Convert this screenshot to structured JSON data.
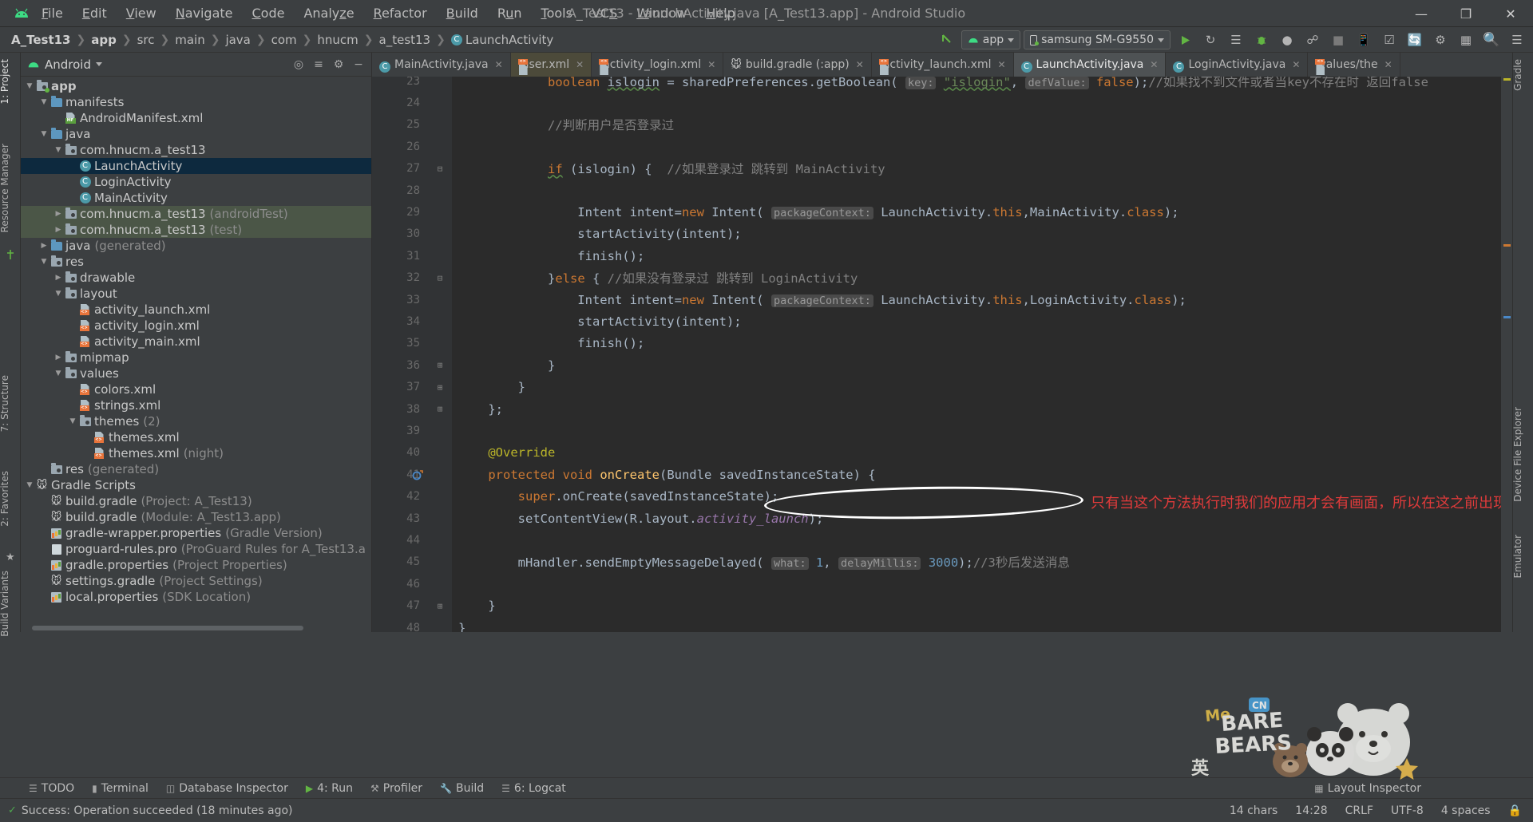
{
  "window": {
    "title": "A_Test13 - LaunchActivity.java [A_Test13.app] - Android Studio",
    "minimize": "—",
    "maximize": "❐",
    "close": "✕"
  },
  "menu": [
    {
      "label": "File"
    },
    {
      "label": "Edit"
    },
    {
      "label": "View"
    },
    {
      "label": "Navigate"
    },
    {
      "label": "Code"
    },
    {
      "label": "Analyze"
    },
    {
      "label": "Refactor"
    },
    {
      "label": "Build"
    },
    {
      "label": "Run"
    },
    {
      "label": "Tools"
    },
    {
      "label": "VCS"
    },
    {
      "label": "Window"
    },
    {
      "label": "Help"
    }
  ],
  "breadcrumb": [
    {
      "label": "A_Test13",
      "bold": true
    },
    {
      "label": "app",
      "bold": true
    },
    {
      "label": "src",
      "bold": false
    },
    {
      "label": "main",
      "bold": false
    },
    {
      "label": "java",
      "bold": false
    },
    {
      "label": "com",
      "bold": false
    },
    {
      "label": "hnucm",
      "bold": false
    },
    {
      "label": "a_test13",
      "bold": false
    },
    {
      "label": "LaunchActivity",
      "bold": false,
      "icon": "class-icon"
    }
  ],
  "toolbar": {
    "module_selector": "app",
    "device_selector": "samsung SM-G9550",
    "run_icon": "run-icon",
    "rerun_icon": "rerun-icon",
    "apply_changes_icon": "apply-changes-icon",
    "debug_icon": "debug-icon",
    "profile_icon": "profile-icon",
    "attach_debugger_icon": "attach-debugger-icon",
    "stop_icon": "stop-icon",
    "avd_icon": "avd-manager-icon",
    "sdk_icon": "sdk-manager-icon",
    "sync_icon": "sync-gradle-icon",
    "search_icon": "search-icon",
    "layout_icon": "layout-inspector-icon"
  },
  "left_rail": [
    {
      "label": "1: Project",
      "active": true
    },
    {
      "label": "Resource Manager",
      "active": false
    },
    {
      "label": "7: Structure",
      "active": false
    },
    {
      "label": "2: Favorites",
      "active": false
    },
    {
      "label": "Build Variants",
      "active": false
    }
  ],
  "right_rail": [
    {
      "label": "Gradle"
    },
    {
      "label": "Device File Explorer"
    },
    {
      "label": "Emulator"
    }
  ],
  "project_panel": {
    "view_selector": "Android",
    "locate_icon": "locate-icon",
    "collapse_icon": "collapse-all-icon",
    "settings_icon": "gear-icon",
    "hide_icon": "hide-icon",
    "tree": [
      {
        "depth": 0,
        "arrow": "down",
        "icon": "folder-module",
        "label": "app",
        "bold": true,
        "dim": ""
      },
      {
        "depth": 1,
        "arrow": "down",
        "icon": "folder-blue",
        "label": "manifests",
        "dim": ""
      },
      {
        "depth": 2,
        "arrow": "none",
        "icon": "manifest-file",
        "label": "AndroidManifest.xml",
        "dim": ""
      },
      {
        "depth": 1,
        "arrow": "down",
        "icon": "folder-blue",
        "label": "java",
        "dim": ""
      },
      {
        "depth": 2,
        "arrow": "down",
        "icon": "folder-src",
        "label": "com.hnucm.a_test13",
        "dim": ""
      },
      {
        "depth": 3,
        "arrow": "none",
        "icon": "class-icon",
        "label": "LaunchActivity",
        "dim": "",
        "state": "selected"
      },
      {
        "depth": 3,
        "arrow": "none",
        "icon": "class-icon",
        "label": "LoginActivity",
        "dim": ""
      },
      {
        "depth": 3,
        "arrow": "none",
        "icon": "class-icon",
        "label": "MainActivity",
        "dim": ""
      },
      {
        "depth": 2,
        "arrow": "right",
        "icon": "folder-src",
        "label": "com.hnucm.a_test13",
        "dim": "(androidTest)",
        "state": "green"
      },
      {
        "depth": 2,
        "arrow": "right",
        "icon": "folder-src",
        "label": "com.hnucm.a_test13",
        "dim": "(test)",
        "state": "green"
      },
      {
        "depth": 1,
        "arrow": "right",
        "icon": "folder-gen",
        "label": "java",
        "dim": "(generated)"
      },
      {
        "depth": 1,
        "arrow": "down",
        "icon": "folder-res",
        "label": "res",
        "dim": ""
      },
      {
        "depth": 2,
        "arrow": "right",
        "icon": "folder-src",
        "label": "drawable",
        "dim": ""
      },
      {
        "depth": 2,
        "arrow": "down",
        "icon": "folder-src",
        "label": "layout",
        "dim": ""
      },
      {
        "depth": 3,
        "arrow": "none",
        "icon": "xml-file",
        "label": "activity_launch.xml",
        "dim": ""
      },
      {
        "depth": 3,
        "arrow": "none",
        "icon": "xml-file",
        "label": "activity_login.xml",
        "dim": ""
      },
      {
        "depth": 3,
        "arrow": "none",
        "icon": "xml-file",
        "label": "activity_main.xml",
        "dim": ""
      },
      {
        "depth": 2,
        "arrow": "right",
        "icon": "folder-src",
        "label": "mipmap",
        "dim": ""
      },
      {
        "depth": 2,
        "arrow": "down",
        "icon": "folder-src",
        "label": "values",
        "dim": ""
      },
      {
        "depth": 3,
        "arrow": "none",
        "icon": "xml-file",
        "label": "colors.xml",
        "dim": ""
      },
      {
        "depth": 3,
        "arrow": "none",
        "icon": "xml-file",
        "label": "strings.xml",
        "dim": ""
      },
      {
        "depth": 3,
        "arrow": "down",
        "icon": "folder-src",
        "label": "themes",
        "dim": "(2)"
      },
      {
        "depth": 4,
        "arrow": "none",
        "icon": "xml-file",
        "label": "themes.xml",
        "dim": ""
      },
      {
        "depth": 4,
        "arrow": "none",
        "icon": "xml-file",
        "label": "themes.xml",
        "dim": "(night)"
      },
      {
        "depth": 1,
        "arrow": "none",
        "icon": "folder-res",
        "label": "res",
        "dim": "(generated)"
      },
      {
        "depth": 0,
        "arrow": "down",
        "icon": "gradle-icon",
        "label": "Gradle Scripts",
        "dim": ""
      },
      {
        "depth": 1,
        "arrow": "none",
        "icon": "gradle-icon",
        "label": "build.gradle",
        "dim": "(Project: A_Test13)"
      },
      {
        "depth": 1,
        "arrow": "none",
        "icon": "gradle-icon",
        "label": "build.gradle",
        "dim": "(Module: A_Test13.app)"
      },
      {
        "depth": 1,
        "arrow": "none",
        "icon": "properties-icon",
        "label": "gradle-wrapper.properties",
        "dim": "(Gradle Version)"
      },
      {
        "depth": 1,
        "arrow": "none",
        "icon": "pro-file-icon",
        "label": "proguard-rules.pro",
        "dim": "(ProGuard Rules for A_Test13.a"
      },
      {
        "depth": 1,
        "arrow": "none",
        "icon": "properties-icon",
        "label": "gradle.properties",
        "dim": "(Project Properties)"
      },
      {
        "depth": 1,
        "arrow": "none",
        "icon": "gradle-icon",
        "label": "settings.gradle",
        "dim": "(Project Settings)"
      },
      {
        "depth": 1,
        "arrow": "none",
        "icon": "properties-icon",
        "label": "local.properties",
        "dim": "(SDK Location)"
      }
    ]
  },
  "editor_tabs": [
    {
      "label": "MainActivity.java",
      "icon": "class-icon",
      "state": "normal"
    },
    {
      "label": "user.xml",
      "icon": "xml-file",
      "state": "modified"
    },
    {
      "label": "activity_login.xml",
      "icon": "xml-file",
      "state": "normal"
    },
    {
      "label": "build.gradle (:app)",
      "icon": "gradle-icon",
      "state": "normal"
    },
    {
      "label": "activity_launch.xml",
      "icon": "xml-file",
      "state": "normal"
    },
    {
      "label": "LaunchActivity.java",
      "icon": "class-icon",
      "state": "active"
    },
    {
      "label": "LoginActivity.java",
      "icon": "class-icon",
      "state": "normal"
    },
    {
      "label": "values/the",
      "icon": "xml-file",
      "state": "normal"
    }
  ],
  "code": {
    "first_line": 23,
    "lines": [
      {
        "n": 23,
        "fold": "",
        "html": "            <span class=\"kw\">boolean</span> <span class=\"wavy\">islogin</span> = sharedPreferences.getBoolean( <span class=\"hint\">key:</span> <span class=\"str wavy\">\"islogin\"</span>, <span class=\"hint\">defValue:</span> <span class=\"kw\">false</span>);<span class=\"cmt\">//如果找不到文件或者当key不存在时 返回false</span>"
      },
      {
        "n": 24,
        "fold": "",
        "html": ""
      },
      {
        "n": 25,
        "fold": "",
        "html": "            <span class=\"cmt\">//判断用户是否登录过</span>"
      },
      {
        "n": 26,
        "fold": "",
        "html": ""
      },
      {
        "n": 27,
        "fold": "minus",
        "html": "            <span class=\"kw wavy\">if</span> (islogin) {  <span class=\"cmt\">//如果登录过 跳转到 MainActivity</span>"
      },
      {
        "n": 28,
        "fold": "",
        "html": ""
      },
      {
        "n": 29,
        "fold": "",
        "html": "                Intent intent=<span class=\"kw\">new</span> Intent( <span class=\"hint\">packageContext:</span> LaunchActivity.<span class=\"kw\">this</span>,MainActivity.<span class=\"kw\">class</span>);"
      },
      {
        "n": 30,
        "fold": "",
        "html": "                startActivity(intent);"
      },
      {
        "n": 31,
        "fold": "",
        "html": "                finish();"
      },
      {
        "n": 32,
        "fold": "minus",
        "html": "            }<span class=\"kw\">else</span> { <span class=\"cmt\">//如果没有登录过 跳转到 LoginActivity</span>"
      },
      {
        "n": 33,
        "fold": "",
        "html": "                Intent intent=<span class=\"kw\">new</span> Intent( <span class=\"hint\">packageContext:</span> LaunchActivity.<span class=\"kw\">this</span>,LoginActivity.<span class=\"kw\">class</span>);"
      },
      {
        "n": 34,
        "fold": "",
        "html": "                startActivity(intent);"
      },
      {
        "n": 35,
        "fold": "",
        "html": "                finish();"
      },
      {
        "n": 36,
        "fold": "plus",
        "html": "            }"
      },
      {
        "n": 37,
        "fold": "plus",
        "html": "        }"
      },
      {
        "n": 38,
        "fold": "plus",
        "html": "    };"
      },
      {
        "n": 39,
        "fold": "",
        "html": ""
      },
      {
        "n": 40,
        "fold": "",
        "html": "    <span class=\"ann\">@Override</span>"
      },
      {
        "n": 41,
        "fold": "",
        "html": "    <span class=\"kw\">protected void</span> <span class=\"mth\">onCreate</span>(Bundle savedInstanceState) {"
      },
      {
        "n": 42,
        "fold": "",
        "html": "        <span class=\"kw\">super</span>.onCreate(savedInstanceState);"
      },
      {
        "n": 43,
        "fold": "",
        "html": "        setContentView(R.layout.<span class=\"fld italic\">activity_launch</span>);"
      },
      {
        "n": 44,
        "fold": "",
        "html": ""
      },
      {
        "n": 45,
        "fold": "",
        "html": "        mHandler.sendEmptyMessageDelayed( <span class=\"hint\">what:</span> <span class=\"num\">1</span>, <span class=\"hint\">delayMillis:</span> <span class=\"num\">3000</span>);<span class=\"cmt\">//3秒后发送消息</span>"
      },
      {
        "n": 46,
        "fold": "",
        "html": ""
      },
      {
        "n": 47,
        "fold": "plus",
        "html": "    }"
      },
      {
        "n": 48,
        "fold": "",
        "html": "}"
      },
      {
        "n": 49,
        "fold": "",
        "html": ""
      }
    ]
  },
  "annotation": {
    "text": "只有当这个方法执行时我们的应用才会有画面，所以在这之前出现空白",
    "color": "#e03b3b",
    "ellipse_shape": "ellipse-highlight"
  },
  "bottom_tools": [
    {
      "label": "TODO",
      "icon": "todo-icon"
    },
    {
      "label": "Terminal",
      "icon": "terminal-icon"
    },
    {
      "label": "Database Inspector",
      "icon": "database-icon"
    },
    {
      "label": "4: Run",
      "icon": "run-icon"
    },
    {
      "label": "Profiler",
      "icon": "profiler-icon"
    },
    {
      "label": "Build",
      "icon": "build-icon"
    },
    {
      "label": "6: Logcat",
      "icon": "logcat-icon"
    },
    {
      "label": "Layout Inspector",
      "icon": "layout-inspector-icon"
    }
  ],
  "status_bar": {
    "message": "Success: Operation succeeded (18 minutes ago)",
    "check_icon": "check-icon",
    "chars": "14 chars",
    "position": "14:28",
    "line_ending": "CRLF",
    "encoding": "UTF-8",
    "indent": "4 spaces",
    "lock_icon": "lock-icon"
  },
  "colors": {
    "chrome": "#3c3f41",
    "editor_bg": "#2b2b2b",
    "gutter_bg": "#313335",
    "accent_green": "#62b543",
    "selection": "#0d293e",
    "green_row": "#4b5647",
    "annotation_red": "#e03b3b",
    "keyword_orange": "#cc7832",
    "string_green": "#6a8759",
    "number_blue": "#6897bb",
    "comment_gray": "#808080",
    "annotation_yellow": "#bbb529",
    "field_purple": "#9876aa",
    "method_gold": "#ffc66d"
  }
}
